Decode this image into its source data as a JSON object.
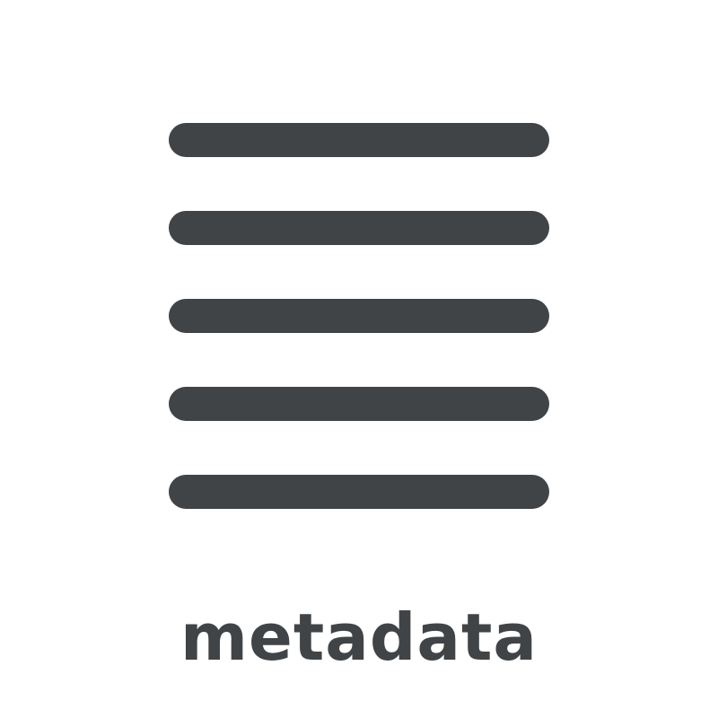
{
  "icon": {
    "name": "lines-list-icon",
    "color": "#414447"
  },
  "label": "metadata",
  "background_color": "#ffffff"
}
